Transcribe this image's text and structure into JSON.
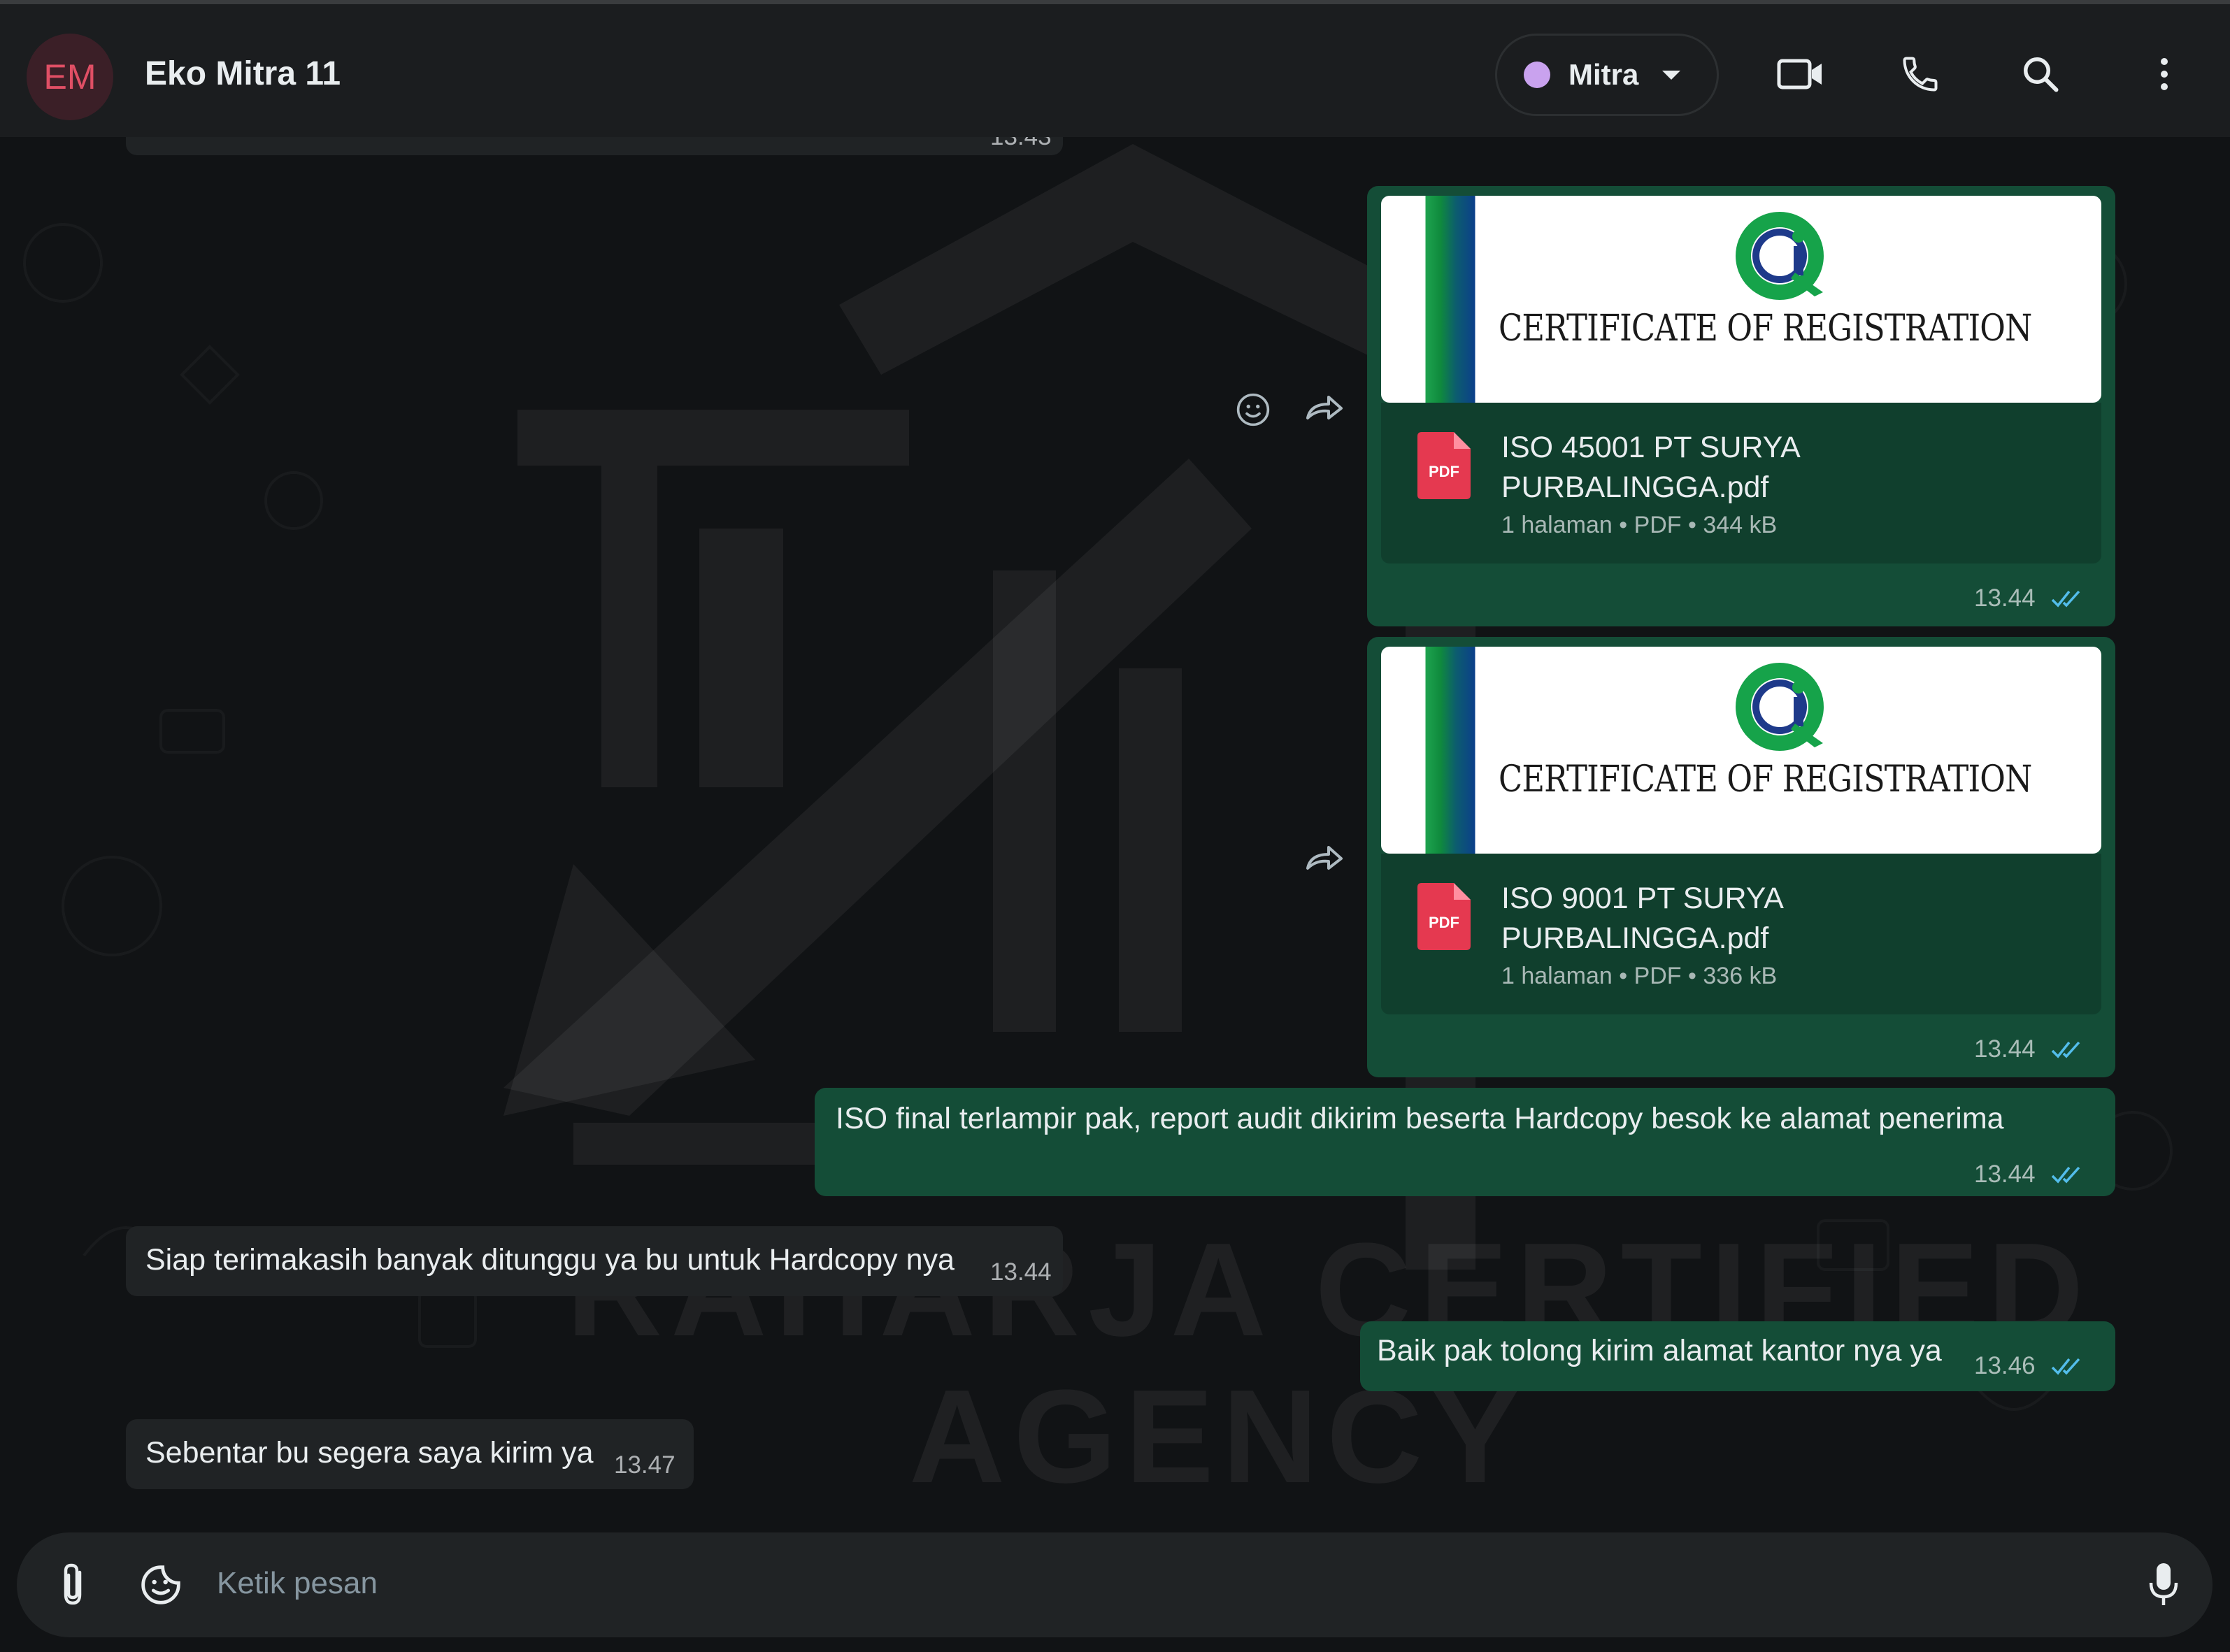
{
  "header": {
    "avatar_initials": "EM",
    "contact_name": "Eko Mitra 11",
    "label_name": "Mitra",
    "label_color": "#c9a2ee"
  },
  "watermark": {
    "line1": "RAHARJA CERTIFIED",
    "line2": "AGENCY"
  },
  "messages": [
    {
      "type": "document",
      "direction": "outgoing",
      "preview_title": "CERTIFICATE OF REGISTRATION",
      "file_name_line1": "ISO 45001 PT SURYA",
      "file_name_line2": "PURBALINGGA.pdf",
      "meta": "1 halaman • PDF • 344 kB",
      "time": "13.44",
      "pdf_badge": "PDF"
    },
    {
      "type": "document",
      "direction": "outgoing",
      "preview_title": "CERTIFICATE OF REGISTRATION",
      "file_name_line1": "ISO 9001 PT SURYA",
      "file_name_line2": "PURBALINGGA.pdf",
      "meta": "1 halaman • PDF • 336 kB",
      "time": "13.44",
      "pdf_badge": "PDF"
    },
    {
      "type": "text",
      "direction": "outgoing",
      "text": "ISO final terlampir pak, report audit dikirim beserta Hardcopy besok ke alamat penerima",
      "time": "13.44"
    },
    {
      "type": "text",
      "direction": "incoming",
      "text": "Siap terimakasih banyak ditunggu ya bu untuk Hardcopy nya",
      "time": "13.44"
    },
    {
      "type": "text",
      "direction": "outgoing",
      "text": "Baik pak tolong kirim alamat kantor nya ya",
      "time": "13.46"
    },
    {
      "type": "text",
      "direction": "incoming",
      "text": "Sebentar bu segera saya kirim ya",
      "time": "13.47"
    }
  ],
  "previous_message_time": "13.43",
  "composer": {
    "placeholder": "Ketik pesan"
  },
  "icons": {
    "header": [
      "video-call-icon",
      "voice-call-icon",
      "search-icon",
      "more-options-icon"
    ],
    "composer": [
      "attach-icon",
      "sticker-icon",
      "microphone-icon"
    ],
    "message_actions": [
      "emoji-reaction-icon",
      "forward-icon"
    ]
  },
  "colors": {
    "outgoing_bubble": "#144d37",
    "incoming_bubble": "#202325",
    "read_ticks": "#53bdeb",
    "header_bg": "#1b1d1f"
  }
}
